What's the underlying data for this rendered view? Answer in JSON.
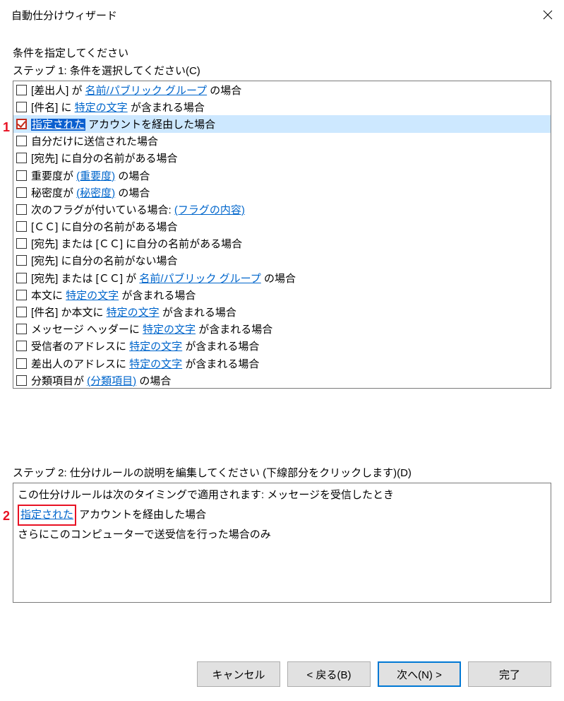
{
  "title": "自動仕分けウィザード",
  "instruction": "条件を指定してください",
  "step1_label": "ステップ 1: 条件を選択してください(C)",
  "markers": {
    "m1": "1",
    "m2": "2"
  },
  "conditions": [
    {
      "segs": [
        {
          "t": "[差出人] が "
        },
        {
          "t": "名前/パブリック グループ",
          "link": true
        },
        {
          "t": " の場合"
        }
      ],
      "checked": false,
      "selected": false
    },
    {
      "segs": [
        {
          "t": "[件名] に "
        },
        {
          "t": "特定の文字",
          "link": true
        },
        {
          "t": " が含まれる場合"
        }
      ],
      "checked": false,
      "selected": false
    },
    {
      "segs": [
        {
          "t": "指定された",
          "link": true,
          "selhl": true
        },
        {
          "t": " アカウントを経由した場合"
        }
      ],
      "checked": true,
      "selected": true
    },
    {
      "segs": [
        {
          "t": "自分だけに送信された場合"
        }
      ],
      "checked": false,
      "selected": false
    },
    {
      "segs": [
        {
          "t": "[宛先] に自分の名前がある場合"
        }
      ],
      "checked": false,
      "selected": false
    },
    {
      "segs": [
        {
          "t": "重要度が "
        },
        {
          "t": "(重要度)",
          "link": true
        },
        {
          "t": " の場合"
        }
      ],
      "checked": false,
      "selected": false
    },
    {
      "segs": [
        {
          "t": "秘密度が "
        },
        {
          "t": "(秘密度)",
          "link": true
        },
        {
          "t": " の場合"
        }
      ],
      "checked": false,
      "selected": false
    },
    {
      "segs": [
        {
          "t": "次のフラグが付いている場合: "
        },
        {
          "t": "(フラグの内容)",
          "link": true
        }
      ],
      "checked": false,
      "selected": false
    },
    {
      "segs": [
        {
          "t": "[ＣＣ] に自分の名前がある場合"
        }
      ],
      "checked": false,
      "selected": false
    },
    {
      "segs": [
        {
          "t": "[宛先] または [ＣＣ] に自分の名前がある場合"
        }
      ],
      "checked": false,
      "selected": false
    },
    {
      "segs": [
        {
          "t": "[宛先] に自分の名前がない場合"
        }
      ],
      "checked": false,
      "selected": false
    },
    {
      "segs": [
        {
          "t": "[宛先] または [ＣＣ] が "
        },
        {
          "t": "名前/パブリック グループ",
          "link": true
        },
        {
          "t": " の場合"
        }
      ],
      "checked": false,
      "selected": false
    },
    {
      "segs": [
        {
          "t": "本文に "
        },
        {
          "t": "特定の文字",
          "link": true
        },
        {
          "t": " が含まれる場合"
        }
      ],
      "checked": false,
      "selected": false
    },
    {
      "segs": [
        {
          "t": "[件名] か本文に "
        },
        {
          "t": "特定の文字",
          "link": true
        },
        {
          "t": " が含まれる場合"
        }
      ],
      "checked": false,
      "selected": false
    },
    {
      "segs": [
        {
          "t": "メッセージ ヘッダーに "
        },
        {
          "t": "特定の文字",
          "link": true
        },
        {
          "t": " が含まれる場合"
        }
      ],
      "checked": false,
      "selected": false
    },
    {
      "segs": [
        {
          "t": "受信者のアドレスに "
        },
        {
          "t": "特定の文字",
          "link": true
        },
        {
          "t": " が含まれる場合"
        }
      ],
      "checked": false,
      "selected": false
    },
    {
      "segs": [
        {
          "t": "差出人のアドレスに "
        },
        {
          "t": "特定の文字",
          "link": true
        },
        {
          "t": " が含まれる場合"
        }
      ],
      "checked": false,
      "selected": false
    },
    {
      "segs": [
        {
          "t": "分類項目が "
        },
        {
          "t": "(分類項目)",
          "link": true
        },
        {
          "t": " の場合"
        }
      ],
      "checked": false,
      "selected": false
    }
  ],
  "step2_label": "ステップ 2: 仕分けルールの説明を編集してください (下線部分をクリックします)(D)",
  "desc": {
    "line1": "この仕分けルールは次のタイミングで適用されます: メッセージを受信したとき",
    "line2_link": "指定された",
    "line2_rest": " アカウントを経由した場合",
    "line3": "さらにこのコンピューターで送受信を行った場合のみ"
  },
  "buttons": {
    "cancel": "キャンセル",
    "back": "< 戻る(B)",
    "next": "次へ(N) >",
    "finish": "完了"
  }
}
